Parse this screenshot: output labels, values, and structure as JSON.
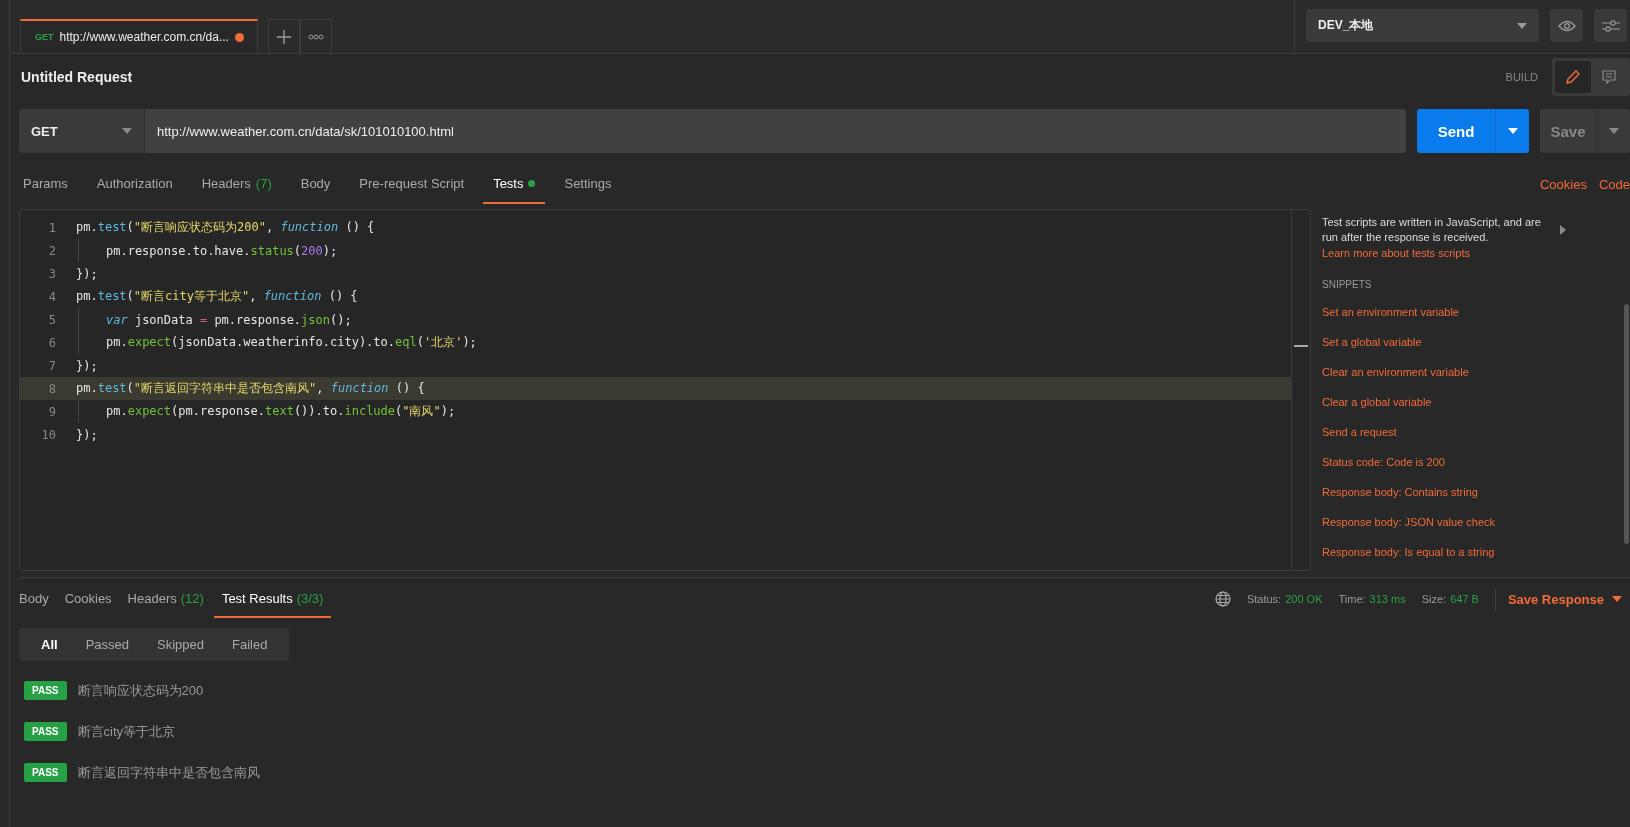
{
  "request_tab": {
    "method": "GET",
    "url": "http://www.weather.com.cn/da...",
    "unsaved": true,
    "selected": true
  },
  "environment": {
    "value": "DEV_本地"
  },
  "request": {
    "title": "Untitled Request",
    "mode_label": "BUILD",
    "method": "GET",
    "url": "http://www.weather.com.cn/data/sk/101010100.html",
    "send_label": "Send",
    "save_label": "Save"
  },
  "request_tabs": [
    {
      "label": "Params",
      "dot": false,
      "selected": false
    },
    {
      "label": "Authorization",
      "dot": false,
      "selected": false
    },
    {
      "label": "Headers",
      "count": "(7)",
      "dot": false,
      "selected": false
    },
    {
      "label": "Body",
      "dot": false,
      "selected": false
    },
    {
      "label": "Pre-request Script",
      "dot": false,
      "selected": false
    },
    {
      "label": "Tests",
      "dot": true,
      "selected": true
    },
    {
      "label": "Settings",
      "dot": false,
      "selected": false
    }
  ],
  "request_links": [
    "Cookies",
    "Code"
  ],
  "editor": {
    "lines": [
      {
        "no": "1",
        "active": false,
        "indent": false,
        "tokens": [
          {
            "t": "pm.",
            "kind": "plain"
          },
          {
            "t": "test",
            "kind": "method"
          },
          {
            "t": "(",
            "kind": "plain"
          },
          {
            "t": "\"断言响应状态码为200\"",
            "kind": "string"
          },
          {
            "t": ", ",
            "kind": "plain"
          },
          {
            "t": "function",
            "kind": "keyword"
          },
          {
            "t": " () {",
            "kind": "plain"
          }
        ]
      },
      {
        "no": "2",
        "active": false,
        "indent": true,
        "tokens": [
          {
            "t": "pm.response.to.have.",
            "kind": "plain"
          },
          {
            "t": "status",
            "kind": "call"
          },
          {
            "t": "(",
            "kind": "plain"
          },
          {
            "t": "200",
            "kind": "number"
          },
          {
            "t": ");",
            "kind": "plain"
          }
        ]
      },
      {
        "no": "3",
        "active": false,
        "indent": false,
        "tokens": [
          {
            "t": "});",
            "kind": "plain"
          }
        ]
      },
      {
        "no": "4",
        "active": false,
        "indent": false,
        "tokens": [
          {
            "t": "pm.",
            "kind": "plain"
          },
          {
            "t": "test",
            "kind": "method"
          },
          {
            "t": "(",
            "kind": "plain"
          },
          {
            "t": "\"断言city等于北京\"",
            "kind": "string"
          },
          {
            "t": ", ",
            "kind": "plain"
          },
          {
            "t": "function",
            "kind": "keyword"
          },
          {
            "t": " () {",
            "kind": "plain"
          }
        ]
      },
      {
        "no": "5",
        "active": false,
        "indent": true,
        "tokens": [
          {
            "t": "var",
            "kind": "keyword"
          },
          {
            "t": " jsonData ",
            "kind": "plain"
          },
          {
            "t": "=",
            "kind": "operator"
          },
          {
            "t": " pm.response.",
            "kind": "plain"
          },
          {
            "t": "json",
            "kind": "call"
          },
          {
            "t": "();",
            "kind": "plain"
          }
        ]
      },
      {
        "no": "6",
        "active": false,
        "indent": true,
        "tokens": [
          {
            "t": "pm.",
            "kind": "plain"
          },
          {
            "t": "expect",
            "kind": "call"
          },
          {
            "t": "(jsonData.weatherinfo.city).to.",
            "kind": "plain"
          },
          {
            "t": "eql",
            "kind": "call"
          },
          {
            "t": "(",
            "kind": "plain"
          },
          {
            "t": "'北京'",
            "kind": "string"
          },
          {
            "t": ");",
            "kind": "plain"
          }
        ]
      },
      {
        "no": "7",
        "active": false,
        "indent": false,
        "tokens": [
          {
            "t": "});",
            "kind": "plain"
          }
        ]
      },
      {
        "no": "8",
        "active": true,
        "indent": false,
        "tokens": [
          {
            "t": "pm.",
            "kind": "plain"
          },
          {
            "t": "test",
            "kind": "method"
          },
          {
            "t": "(",
            "kind": "plain"
          },
          {
            "t": "\"断言返回字符串中是否包含南风\"",
            "kind": "string"
          },
          {
            "t": ", ",
            "kind": "plain"
          },
          {
            "t": "function",
            "kind": "keyword"
          },
          {
            "t": " () {",
            "kind": "plain"
          }
        ]
      },
      {
        "no": "9",
        "active": false,
        "indent": true,
        "tokens": [
          {
            "t": "pm.",
            "kind": "plain"
          },
          {
            "t": "expect",
            "kind": "call"
          },
          {
            "t": "(pm.response.",
            "kind": "plain"
          },
          {
            "t": "text",
            "kind": "call"
          },
          {
            "t": "()).to.",
            "kind": "plain"
          },
          {
            "t": "include",
            "kind": "call"
          },
          {
            "t": "(",
            "kind": "plain"
          },
          {
            "t": "\"南风\"",
            "kind": "string"
          },
          {
            "t": ");",
            "kind": "plain"
          }
        ]
      },
      {
        "no": "10",
        "active": false,
        "indent": false,
        "tokens": [
          {
            "t": "});",
            "kind": "plain"
          }
        ]
      }
    ]
  },
  "side_panel": {
    "description": "Test scripts are written in JavaScript, and are run after the response is received.",
    "link": "Learn more about tests scripts",
    "snippets_heading": "SNIPPETS",
    "snippets": [
      "Set an environment variable",
      "Set a global variable",
      "Clear an environment variable",
      "Clear a global variable",
      "Send a request",
      "Status code: Code is 200",
      "Response body: Contains string",
      "Response body: JSON value check",
      "Response body: Is equal to a string"
    ]
  },
  "response_tabs": [
    {
      "label": "Body",
      "selected": false
    },
    {
      "label": "Cookies",
      "selected": false
    },
    {
      "label": "Headers",
      "count": "(12)",
      "selected": false
    },
    {
      "label": "Test Results",
      "count": "(3/3)",
      "selected": true
    }
  ],
  "response_stats": [
    {
      "label": "Status:",
      "value": "200 OK"
    },
    {
      "label": "Time:",
      "value": "313 ms"
    },
    {
      "label": "Size:",
      "value": "647 B"
    }
  ],
  "save_response": "Save Response",
  "filters": [
    {
      "label": "All",
      "selected": true
    },
    {
      "label": "Passed",
      "selected": false
    },
    {
      "label": "Skipped",
      "selected": false
    },
    {
      "label": "Failed",
      "selected": false
    }
  ],
  "results": [
    {
      "status": "PASS",
      "name": "断言响应状态码为200"
    },
    {
      "status": "PASS",
      "name": "断言city等于北京"
    },
    {
      "status": "PASS",
      "name": "断言返回字符串中是否包含南风"
    }
  ]
}
